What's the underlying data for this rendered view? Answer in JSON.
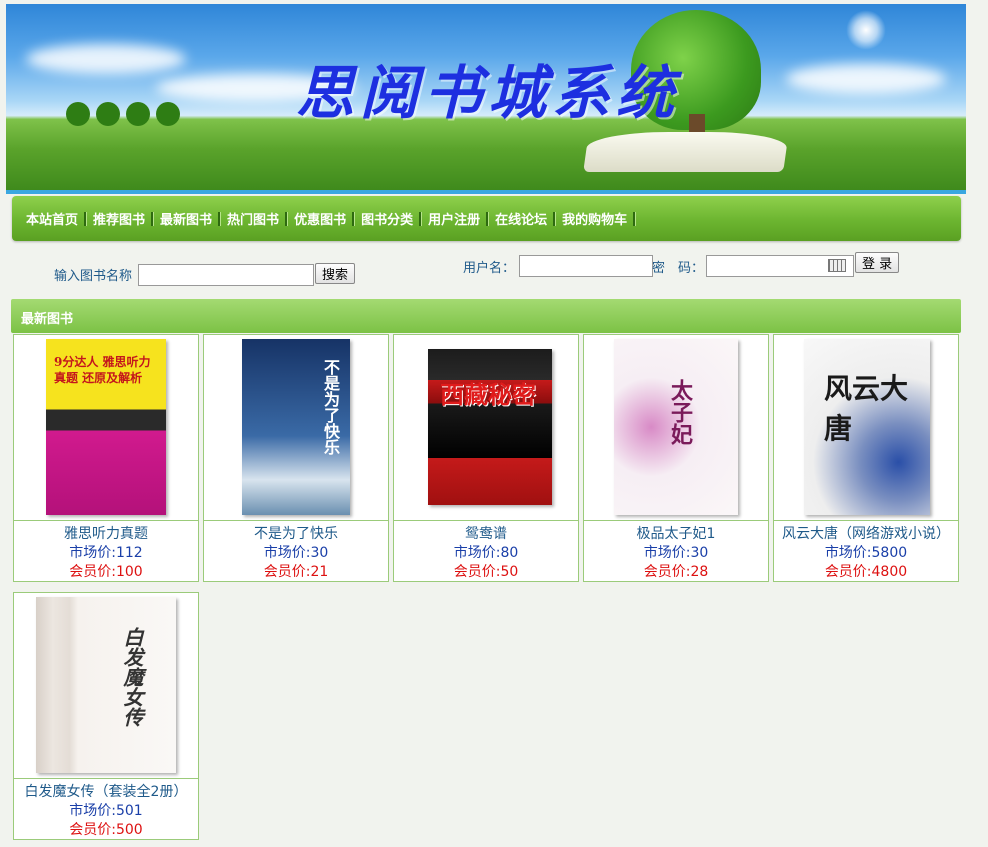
{
  "site": {
    "title": "思阅书城系统"
  },
  "nav": {
    "items": [
      "本站首页",
      "推荐图书",
      "最新图书",
      "热门图书",
      "优惠图书",
      "图书分类",
      "用户注册",
      "在线论坛",
      "我的购物车"
    ]
  },
  "search": {
    "label": "输入图书名称",
    "value": "",
    "button": "搜索"
  },
  "login": {
    "user_label": "用户名：",
    "user_value": "",
    "pwd_label": "密　码：",
    "pwd_value": "",
    "button": "登 录"
  },
  "section": {
    "title": "最新图书"
  },
  "books": [
    {
      "name": "雅思听力真题",
      "market": "市场价:112",
      "member": "会员价:100",
      "cover_text": "9分达人 雅思听力真题 还原及解析",
      "cover_color": "#f5e11a"
    },
    {
      "name": "不是为了快乐",
      "market": "市场价:30",
      "member": "会员价:21",
      "cover_text": "不是为了快乐",
      "cover_color": "#1d3f7a"
    },
    {
      "name": "鸳鸯谱",
      "market": "市场价:80",
      "member": "会员价:50",
      "cover_text": "西藏秘密",
      "cover_color": "#1a1a1a"
    },
    {
      "name": "极品太子妃1",
      "market": "市场价:30",
      "member": "会员价:28",
      "cover_text": "太子妃",
      "cover_color": "#f6f2f2"
    },
    {
      "name": "风云大唐（网络游戏小说）",
      "market": "市场价:5800",
      "member": "会员价:4800",
      "cover_text": "风云大唐",
      "cover_color": "#f4f4f4"
    },
    {
      "name": "白发魔女传（套装全2册）",
      "market": "市场价:501",
      "member": "会员价:500",
      "cover_text": "白发魔女传",
      "cover_color": "#f1ece8"
    }
  ],
  "colors": {
    "nav_green": "#6cb530",
    "link_blue": "#1f5a8a",
    "market_blue": "#1a3fa8",
    "member_red": "#d11"
  }
}
